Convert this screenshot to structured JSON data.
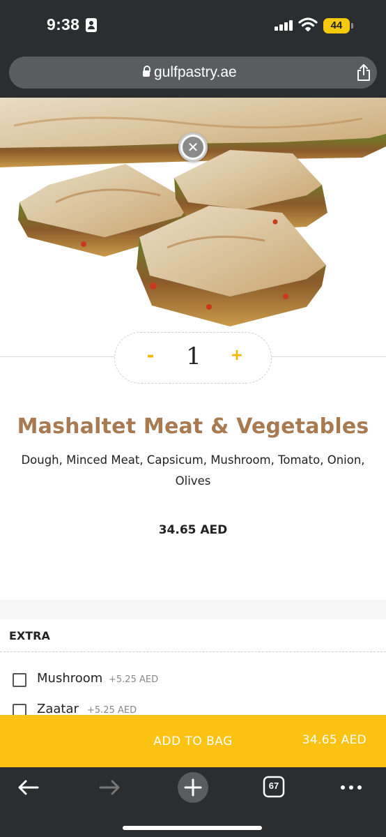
{
  "status_bar": {
    "time": "9:38",
    "battery": "44",
    "icons": [
      "person-id-icon",
      "signal-icon",
      "wifi-icon",
      "battery-icon"
    ],
    "battery_color": "#f5c90e"
  },
  "browser": {
    "url": "gulfpastry.ae",
    "icons": [
      "lock-icon",
      "share-icon"
    ]
  },
  "product": {
    "quantity": "1",
    "minus_label": "-",
    "plus_label": "+",
    "title": "Mashaltet Meat & Vegetables",
    "description": "Dough, Minced Meat, Capsicum, Mushroom, Tomato, Onion, Olives",
    "price": "34.65 AED",
    "title_color": "#a97a52",
    "accent_color": "#f5b400"
  },
  "extras": {
    "title": "EXTRA",
    "options": [
      {
        "label": "Mushroom",
        "price": "+5.25 AED",
        "checked": false
      },
      {
        "label": "Zaatar",
        "price": "+5.25 AED",
        "checked": false
      }
    ]
  },
  "cart": {
    "add_label": "ADD TO BAG",
    "total": "34.65 AED",
    "bar_color": "#fcc315"
  },
  "toolbar": {
    "tabs_count": "67",
    "icons": [
      "back-arrow-icon",
      "forward-arrow-icon",
      "new-tab-plus-icon",
      "tabs-icon",
      "more-icon"
    ]
  }
}
